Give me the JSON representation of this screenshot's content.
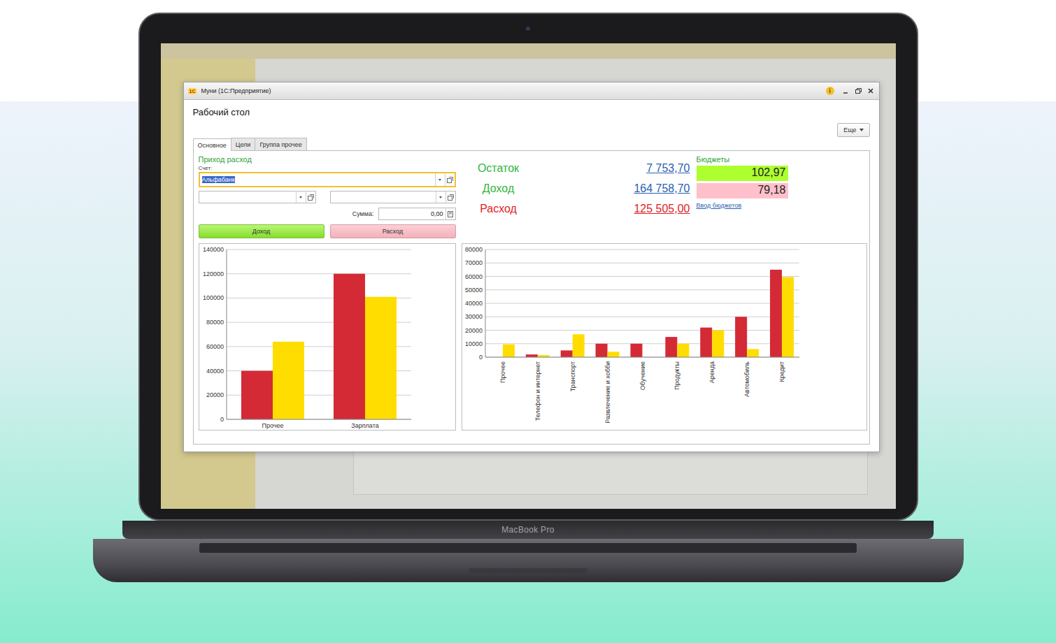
{
  "laptop": {
    "label": "MacBook Pro"
  },
  "window": {
    "logo": "1С",
    "title": "Муни  (1С:Предприятие)",
    "info": "i"
  },
  "page": {
    "title": "Рабочий стол",
    "more_button": "Еще"
  },
  "tabs": [
    {
      "label": "Основное",
      "selected": true
    },
    {
      "label": "Цели",
      "selected": false
    },
    {
      "label": "Группа прочее",
      "selected": false
    }
  ],
  "entry": {
    "title": "Приход расход",
    "account_label": "Счет:",
    "account_value": "Альфабанк",
    "account_selected": true,
    "extra_fields": [
      {
        "value": ""
      },
      {
        "value": ""
      }
    ],
    "sum_label": "Сумма:",
    "sum_value": "0,00",
    "buttons": [
      {
        "label": "Доход",
        "kind": "income"
      },
      {
        "label": "Расход",
        "kind": "expense"
      }
    ]
  },
  "totals": [
    {
      "label": "Остаток",
      "value": "7 753,70",
      "kind": "balance"
    },
    {
      "label": "Доход",
      "value": "164 758,70",
      "kind": "income"
    },
    {
      "label": "Расход",
      "value": "125 505,00",
      "kind": "expense"
    }
  ],
  "budgets": {
    "title": "Бюджеты",
    "items": [
      {
        "value": "102,97",
        "color": "#adff2f"
      },
      {
        "value": "79,18",
        "color": "#ffc0cb"
      }
    ],
    "link": "Ввод бюджетов"
  },
  "charts": [
    {
      "ticks": [
        "0",
        "20000",
        "40000",
        "60000",
        "80000",
        "100000",
        "120000",
        "140000"
      ],
      "categories": [
        "Прочее",
        "Зарплата"
      ],
      "series": [
        {
          "color": "#d42a36",
          "values": [
            40000,
            120000
          ]
        },
        {
          "color": "#ffdd00",
          "values": [
            64000,
            101000
          ]
        }
      ]
    },
    {
      "ticks": [
        "0",
        "10000",
        "20000",
        "30000",
        "40000",
        "50000",
        "60000",
        "70000",
        "80000"
      ],
      "categories": [
        "Прочее",
        "Телефон и интернет",
        "Транспорт",
        "Развлечение и хобби",
        "Обучение",
        "Продукты",
        "Аренда",
        "Автомобиль",
        "Кредит"
      ],
      "series": [
        {
          "color": "#d42a36",
          "values": [
            0,
            2000,
            5000,
            10000,
            10000,
            15000,
            22000,
            30000,
            65000
          ]
        },
        {
          "color": "#ffdd00",
          "values": [
            9500,
            1500,
            17000,
            4000,
            0,
            10000,
            20000,
            6000,
            59500
          ]
        }
      ]
    }
  ]
}
